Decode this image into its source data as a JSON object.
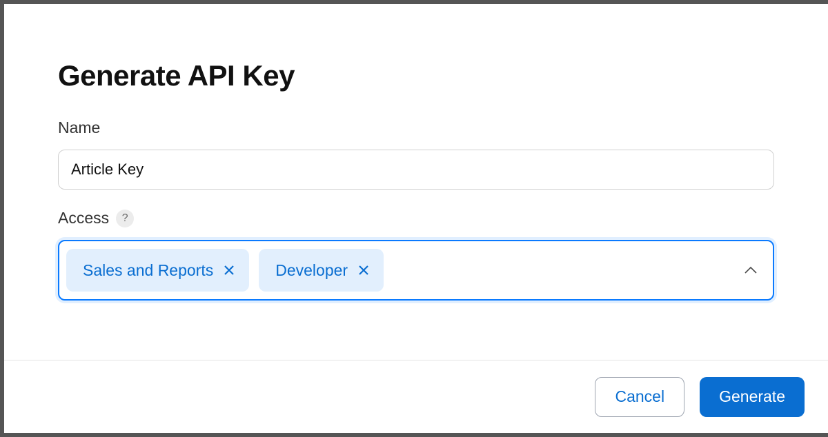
{
  "title": "Generate API Key",
  "fields": {
    "name": {
      "label": "Name",
      "value": "Article Key"
    },
    "access": {
      "label": "Access",
      "tags": [
        {
          "label": "Sales and Reports"
        },
        {
          "label": "Developer"
        }
      ]
    }
  },
  "footer": {
    "cancel": "Cancel",
    "generate": "Generate"
  }
}
